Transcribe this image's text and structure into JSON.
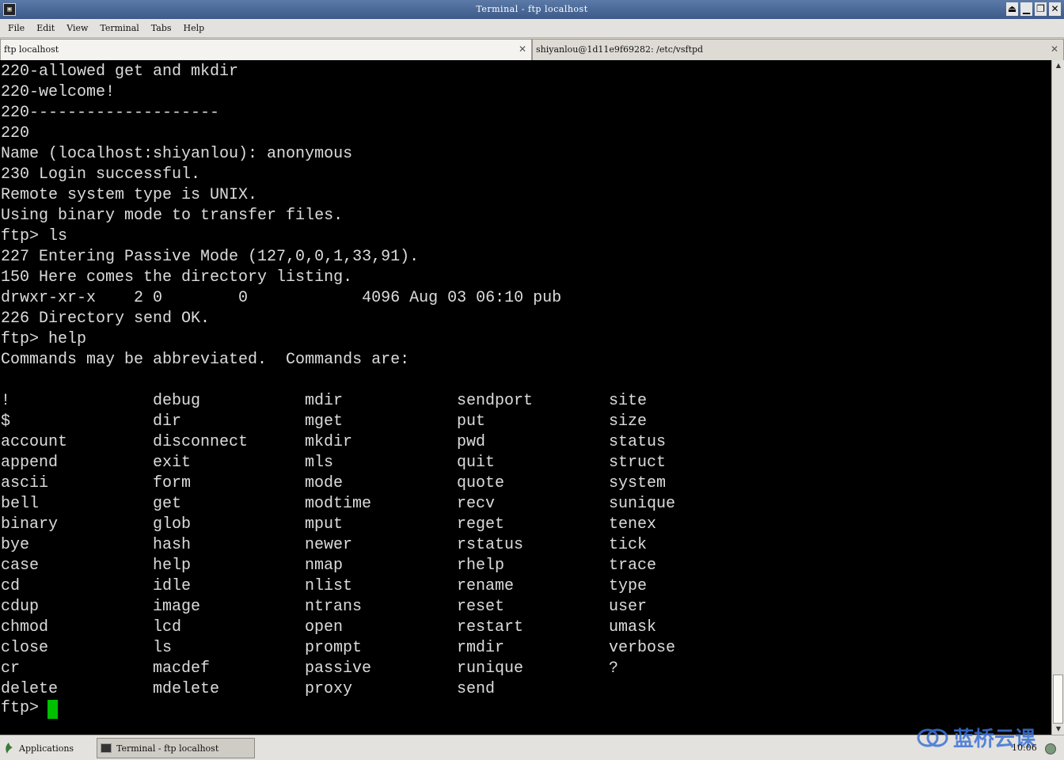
{
  "window": {
    "title": "Terminal - ftp localhost",
    "buttons": [
      "⏏",
      "▁",
      "❐",
      "✕"
    ]
  },
  "menu": [
    "File",
    "Edit",
    "View",
    "Terminal",
    "Tabs",
    "Help"
  ],
  "tabs": [
    {
      "label": "ftp localhost",
      "close": "✕"
    },
    {
      "label": "shiyanlou@1d11e9f69282: /etc/vsftpd",
      "close": "✕"
    }
  ],
  "terminal": {
    "lines": [
      "220-allowed get and mkdir",
      "220-welcome!",
      "220--------------------",
      "220",
      "Name (localhost:shiyanlou): anonymous",
      "230 Login successful.",
      "Remote system type is UNIX.",
      "Using binary mode to transfer files.",
      "ftp> ls",
      "227 Entering Passive Mode (127,0,0,1,33,91).",
      "150 Here comes the directory listing.",
      "drwxr-xr-x    2 0        0            4096 Aug 03 06:10 pub",
      "226 Directory send OK.",
      "ftp> help",
      "Commands may be abbreviated.  Commands are:"
    ],
    "commands": [
      [
        "!",
        "debug",
        "mdir",
        "sendport",
        "site"
      ],
      [
        "$",
        "dir",
        "mget",
        "put",
        "size"
      ],
      [
        "account",
        "disconnect",
        "mkdir",
        "pwd",
        "status"
      ],
      [
        "append",
        "exit",
        "mls",
        "quit",
        "struct"
      ],
      [
        "ascii",
        "form",
        "mode",
        "quote",
        "system"
      ],
      [
        "bell",
        "get",
        "modtime",
        "recv",
        "sunique"
      ],
      [
        "binary",
        "glob",
        "mput",
        "reget",
        "tenex"
      ],
      [
        "bye",
        "hash",
        "newer",
        "rstatus",
        "tick"
      ],
      [
        "case",
        "help",
        "nmap",
        "rhelp",
        "trace"
      ],
      [
        "cd",
        "idle",
        "nlist",
        "rename",
        "type"
      ],
      [
        "cdup",
        "image",
        "ntrans",
        "reset",
        "user"
      ],
      [
        "chmod",
        "lcd",
        "open",
        "restart",
        "umask"
      ],
      [
        "close",
        "ls",
        "prompt",
        "rmdir",
        "verbose"
      ],
      [
        "cr",
        "macdef",
        "passive",
        "runique",
        "?"
      ],
      [
        "delete",
        "mdelete",
        "proxy",
        "send",
        ""
      ]
    ],
    "prompt": "ftp> ",
    "cursor_color": "#00c000"
  },
  "taskbar": {
    "applications_label": "Applications",
    "task_label": "Terminal - ftp localhost",
    "brand_text": "蓝桥云课",
    "clock": "10:06"
  }
}
